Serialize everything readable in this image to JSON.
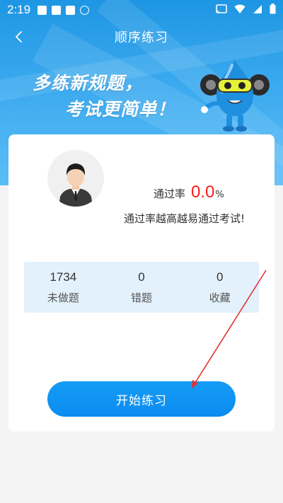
{
  "status_bar": {
    "time": "2:19"
  },
  "header": {
    "title": "顺序练习"
  },
  "banner": {
    "slogan_line1": "多练新规题，",
    "slogan_line2": "考试更简单！"
  },
  "card": {
    "pass_rate_label": "通过率",
    "pass_rate_value": "0.0",
    "pass_rate_unit": "%",
    "tip": "通过率越高越易通过考试!",
    "stats": [
      {
        "value": "1734",
        "label": "未做题"
      },
      {
        "value": "0",
        "label": "错题"
      },
      {
        "value": "0",
        "label": "收藏"
      }
    ],
    "start_button_label": "开始练习"
  },
  "colors": {
    "accent": "#0a8cf0",
    "header_blue": "#1e96e3",
    "pass_rate_red": "#ff1a1a",
    "stats_bg": "#e3f1fd"
  }
}
